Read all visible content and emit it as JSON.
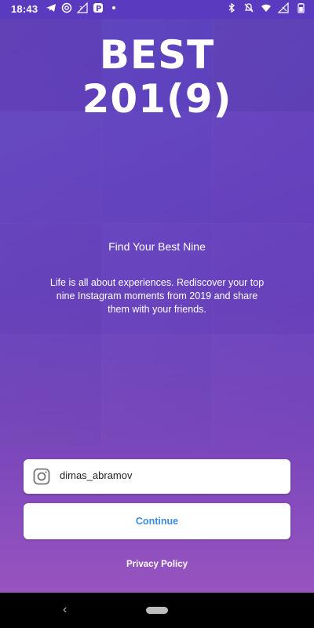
{
  "status_bar": {
    "time": "18:43",
    "left_icons": [
      "telegram-icon",
      "at-icon",
      "signal-question-icon",
      "parking-icon",
      "dot-icon"
    ],
    "right_icons": [
      "bluetooth-icon",
      "mute-icon",
      "wifi-icon",
      "no-sim-icon",
      "battery-icon"
    ]
  },
  "hero": {
    "title_line1": "BEST",
    "title_line2": "201(9)"
  },
  "content": {
    "subtitle": "Find Your Best Nine",
    "description": "Life is all about experiences. Rediscover your top nine Instagram moments from 2019 and share them with your friends."
  },
  "form": {
    "username_value": "dimas_abramov",
    "username_icon": "instagram-icon",
    "continue_label": "Continue",
    "continue_color": "#3b8be0"
  },
  "footer": {
    "privacy_label": "Privacy Policy"
  },
  "nav_bar": {
    "back_symbol": "‹"
  }
}
